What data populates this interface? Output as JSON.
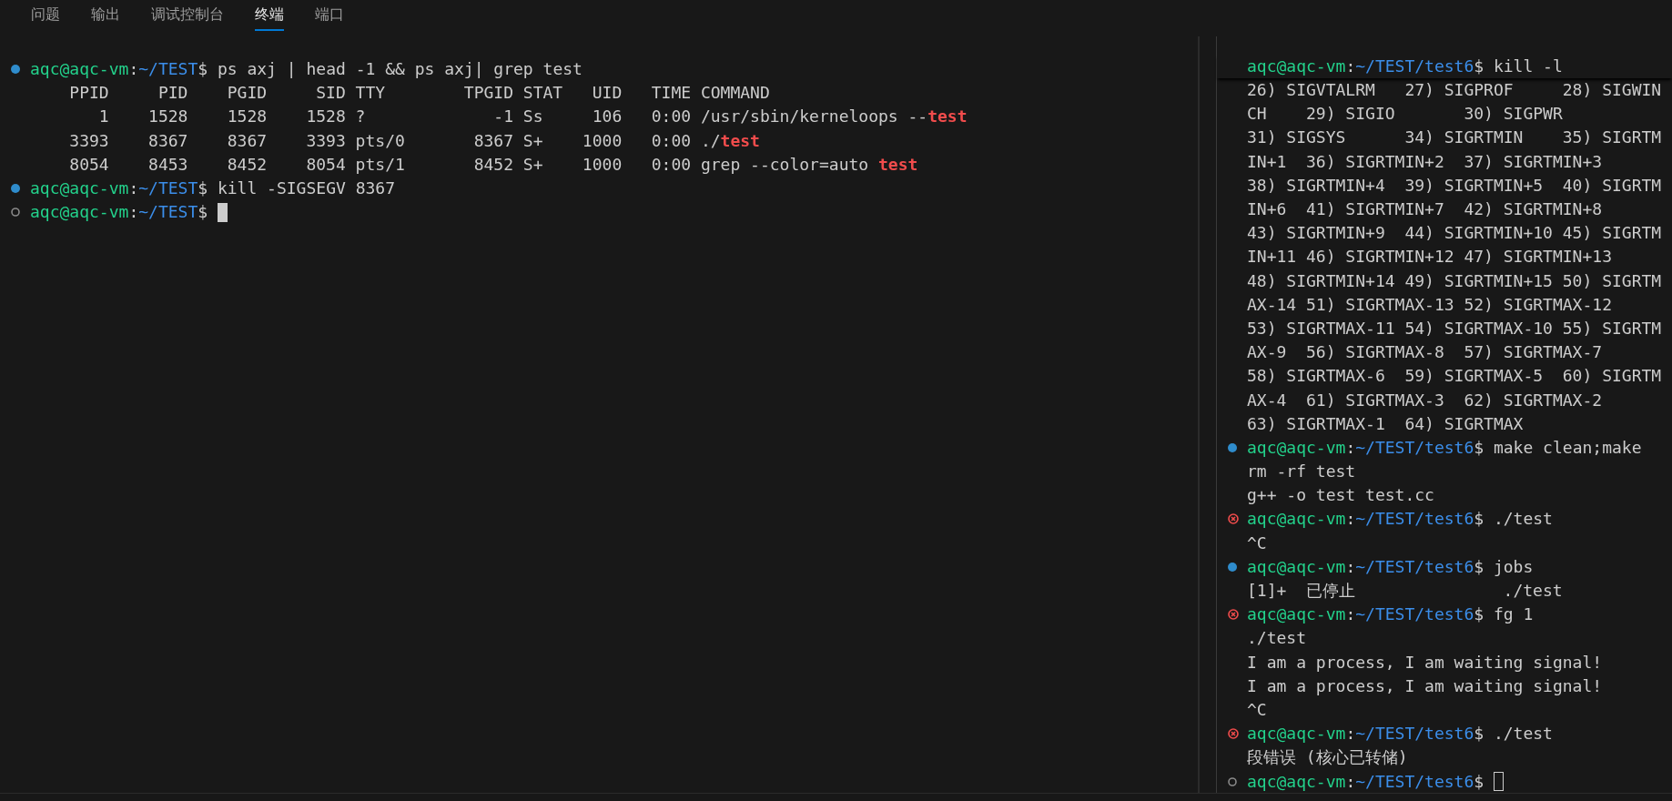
{
  "tabs": [
    {
      "label": "问题",
      "selected": false
    },
    {
      "label": "输出",
      "selected": false
    },
    {
      "label": "调试控制台",
      "selected": false
    },
    {
      "label": "终端",
      "selected": true
    },
    {
      "label": "端口",
      "selected": false
    }
  ],
  "terminals": [
    {
      "lines": [
        {
          "kind": "prompt",
          "ran": true,
          "failed": false,
          "user": "aqc@aqc-vm",
          "sep": ":",
          "path": "~/TEST",
          "symbol": "$",
          "command": "ps axj | head -1 && ps axj| grep test"
        },
        {
          "kind": "output",
          "text": "    PPID     PID    PGID     SID TTY        TPGID STAT   UID   TIME COMMAND"
        },
        {
          "kind": "output",
          "segments": [
            {
              "text": "       1    1528    1528    1528 ?             -1 Ss     106   0:00 /usr/sbin/kerneloops --",
              "match": false
            },
            {
              "text": "test",
              "match": true
            }
          ]
        },
        {
          "kind": "output",
          "segments": [
            {
              "text": "    3393    8367    8367    3393 pts/0       8367 S+    1000   0:00 ./",
              "match": false
            },
            {
              "text": "test",
              "match": true
            }
          ]
        },
        {
          "kind": "output",
          "segments": [
            {
              "text": "    8054    8453    8452    8054 pts/1       8452 S+    1000   0:00 grep --color=auto ",
              "match": false
            },
            {
              "text": "test",
              "match": true
            }
          ]
        },
        {
          "kind": "prompt",
          "ran": true,
          "failed": false,
          "user": "aqc@aqc-vm",
          "sep": ":",
          "path": "~/TEST",
          "symbol": "$",
          "command": "kill -SIGSEGV 8367"
        },
        {
          "kind": "prompt",
          "ran": false,
          "user": "aqc@aqc-vm",
          "sep": ":",
          "path": "~/TEST",
          "symbol": "$",
          "cursor": true,
          "focused": true
        }
      ]
    },
    {
      "sticky": {
        "kind": "prompt",
        "user": "aqc@aqc-vm",
        "sep": ":",
        "path": "~/TEST/test6",
        "symbol": "$",
        "command": "kill -l"
      },
      "lines": [
        {
          "kind": "output",
          "text": "26) SIGVTALRM   27) SIGPROF     28) SIGWIN"
        },
        {
          "kind": "output",
          "text": "CH    29) SIGIO       30) SIGPWR"
        },
        {
          "kind": "output",
          "text": "31) SIGSYS      34) SIGRTMIN    35) SIGRTM"
        },
        {
          "kind": "output",
          "text": "IN+1  36) SIGRTMIN+2  37) SIGRTMIN+3"
        },
        {
          "kind": "output",
          "text": "38) SIGRTMIN+4  39) SIGRTMIN+5  40) SIGRTM"
        },
        {
          "kind": "output",
          "text": "IN+6  41) SIGRTMIN+7  42) SIGRTMIN+8"
        },
        {
          "kind": "output",
          "text": "43) SIGRTMIN+9  44) SIGRTMIN+10 45) SIGRTM"
        },
        {
          "kind": "output",
          "text": "IN+11 46) SIGRTMIN+12 47) SIGRTMIN+13"
        },
        {
          "kind": "output",
          "text": "48) SIGRTMIN+14 49) SIGRTMIN+15 50) SIGRTM"
        },
        {
          "kind": "output",
          "text": "AX-14 51) SIGRTMAX-13 52) SIGRTMAX-12"
        },
        {
          "kind": "output",
          "text": "53) SIGRTMAX-11 54) SIGRTMAX-10 55) SIGRTM"
        },
        {
          "kind": "output",
          "text": "AX-9  56) SIGRTMAX-8  57) SIGRTMAX-7"
        },
        {
          "kind": "output",
          "text": "58) SIGRTMAX-6  59) SIGRTMAX-5  60) SIGRTM"
        },
        {
          "kind": "output",
          "text": "AX-4  61) SIGRTMAX-3  62) SIGRTMAX-2"
        },
        {
          "kind": "output",
          "text": "63) SIGRTMAX-1  64) SIGRTMAX"
        },
        {
          "kind": "prompt",
          "ran": true,
          "failed": false,
          "user": "aqc@aqc-vm",
          "sep": ":",
          "path": "~/TEST/test6",
          "symbol": "$",
          "command": "make clean;make"
        },
        {
          "kind": "output",
          "text": "rm -rf test"
        },
        {
          "kind": "output",
          "text": "g++ -o test test.cc"
        },
        {
          "kind": "prompt",
          "ran": true,
          "failed": true,
          "user": "aqc@aqc-vm",
          "sep": ":",
          "path": "~/TEST/test6",
          "symbol": "$",
          "command": "./test"
        },
        {
          "kind": "output",
          "text": "^C"
        },
        {
          "kind": "prompt",
          "ran": true,
          "failed": false,
          "user": "aqc@aqc-vm",
          "sep": ":",
          "path": "~/TEST/test6",
          "symbol": "$",
          "command": "jobs"
        },
        {
          "kind": "output",
          "text": "[1]+  已停止               ./test"
        },
        {
          "kind": "prompt",
          "ran": true,
          "failed": true,
          "user": "aqc@aqc-vm",
          "sep": ":",
          "path": "~/TEST/test6",
          "symbol": "$",
          "command": "fg 1"
        },
        {
          "kind": "output",
          "text": "./test"
        },
        {
          "kind": "output",
          "text": "I am a process, I am waiting signal!"
        },
        {
          "kind": "output",
          "text": "I am a process, I am waiting signal!"
        },
        {
          "kind": "output",
          "text": "^C"
        },
        {
          "kind": "prompt",
          "ran": true,
          "failed": true,
          "user": "aqc@aqc-vm",
          "sep": ":",
          "path": "~/TEST/test6",
          "symbol": "$",
          "command": "./test"
        },
        {
          "kind": "output",
          "text": "段错误 (核心已转储)"
        },
        {
          "kind": "prompt",
          "ran": false,
          "user": "aqc@aqc-vm",
          "sep": ":",
          "path": "~/TEST/test6",
          "symbol": "$",
          "cursor": true,
          "focused": false
        }
      ]
    }
  ]
}
